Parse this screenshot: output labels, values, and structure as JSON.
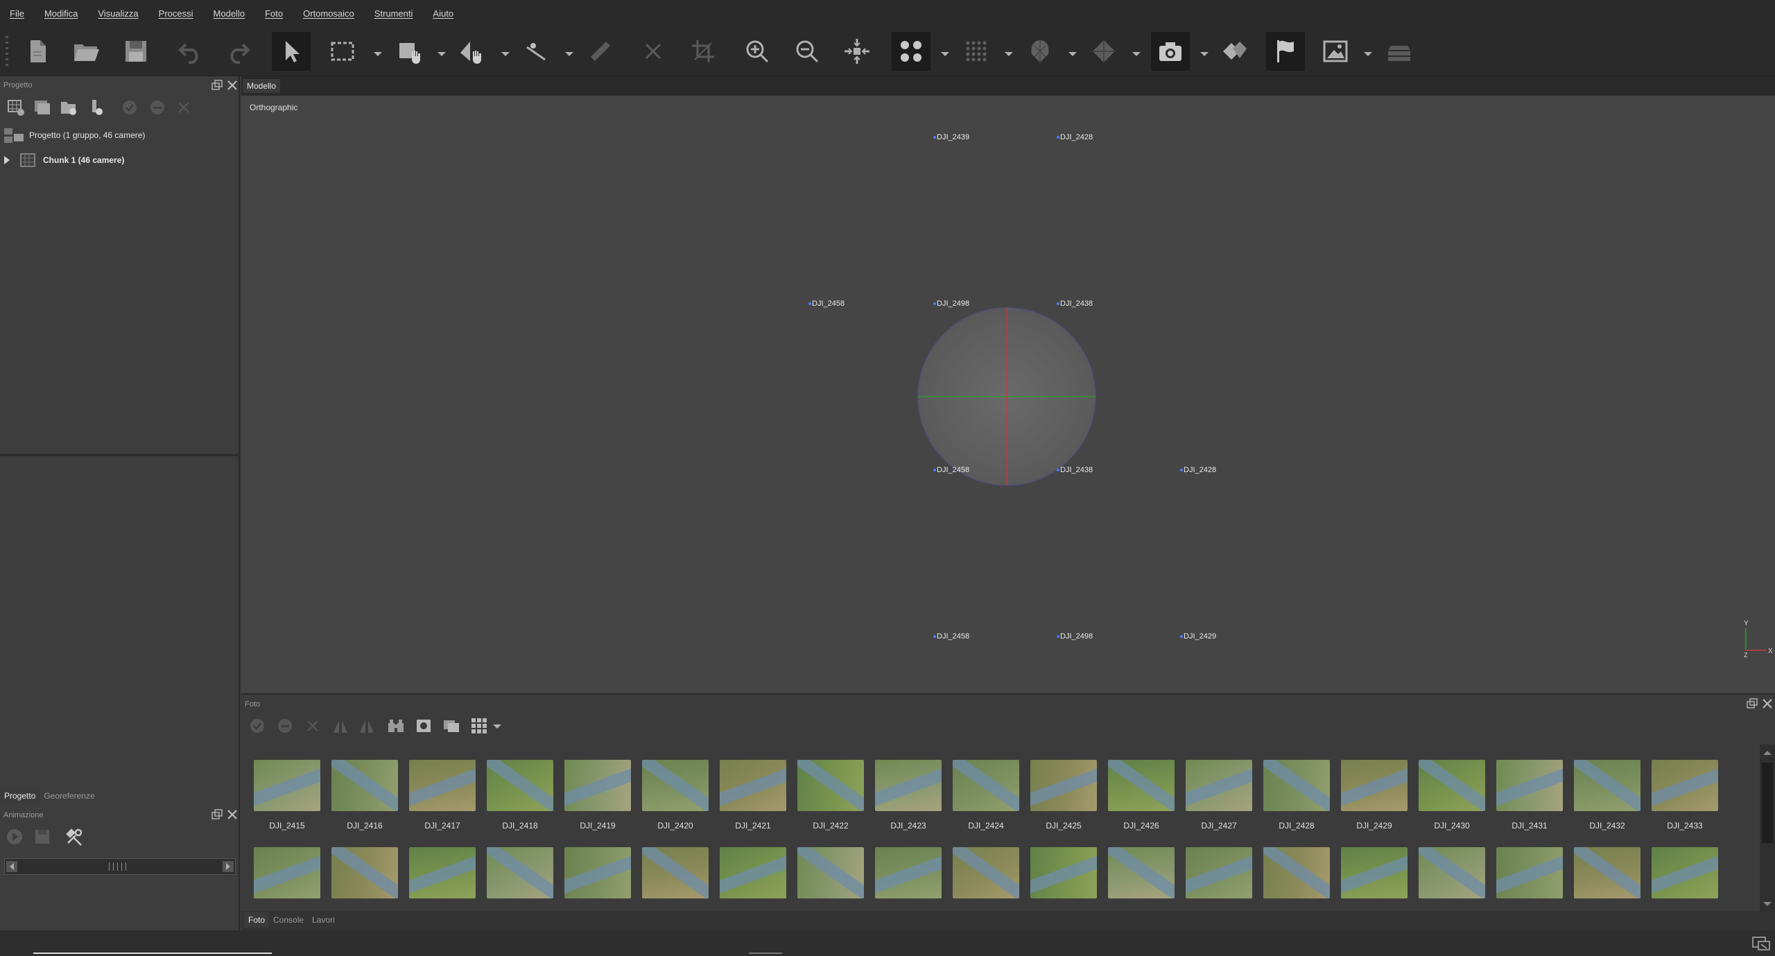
{
  "menu": [
    "File",
    "Modifica",
    "Visualizza",
    "Processi",
    "Modello",
    "Foto",
    "Ortomosaico",
    "Strumenti",
    "Aiuto"
  ],
  "project_panel": {
    "title": "Progetto",
    "root_label": "Progetto (1 gruppo, 46 camere)",
    "chunk_label": "Chunk 1 (46 camere)",
    "tabs": [
      "Progetto",
      "Georeferenze"
    ]
  },
  "animation_panel": {
    "title": "Animazione"
  },
  "model_view": {
    "tab": "Modello",
    "mode": "Orthographic",
    "axis_labels": {
      "x": "X",
      "y": "Y",
      "z": "Z"
    },
    "camera_labels": [
      "DJI_2439",
      "DJI_2428",
      "DJI_2458",
      "DJI_2498",
      "DJI_2438",
      "DJI_2458",
      "DJI_2438",
      "DJI_2428",
      "DJI_2458",
      "DJI_2498",
      "DJI_2429"
    ]
  },
  "photos_panel": {
    "title": "Foto",
    "row1": [
      "DJI_2415",
      "DJI_2416",
      "DJI_2417",
      "DJI_2418",
      "DJI_2419",
      "DJI_2420",
      "DJI_2421",
      "DJI_2422",
      "DJI_2423",
      "DJI_2424",
      "DJI_2425",
      "DJI_2426",
      "DJI_2427",
      "DJI_2428",
      "DJI_2429",
      "DJI_2430",
      "DJI_2431",
      "DJI_2432",
      "DJI_2433"
    ]
  },
  "bottom_tabs": [
    "Foto",
    "Console",
    "Lavori"
  ],
  "colors": {
    "accent_blue": "#4a7cff",
    "axis_green": "#2e9e2e",
    "axis_red": "#c23b3b"
  }
}
